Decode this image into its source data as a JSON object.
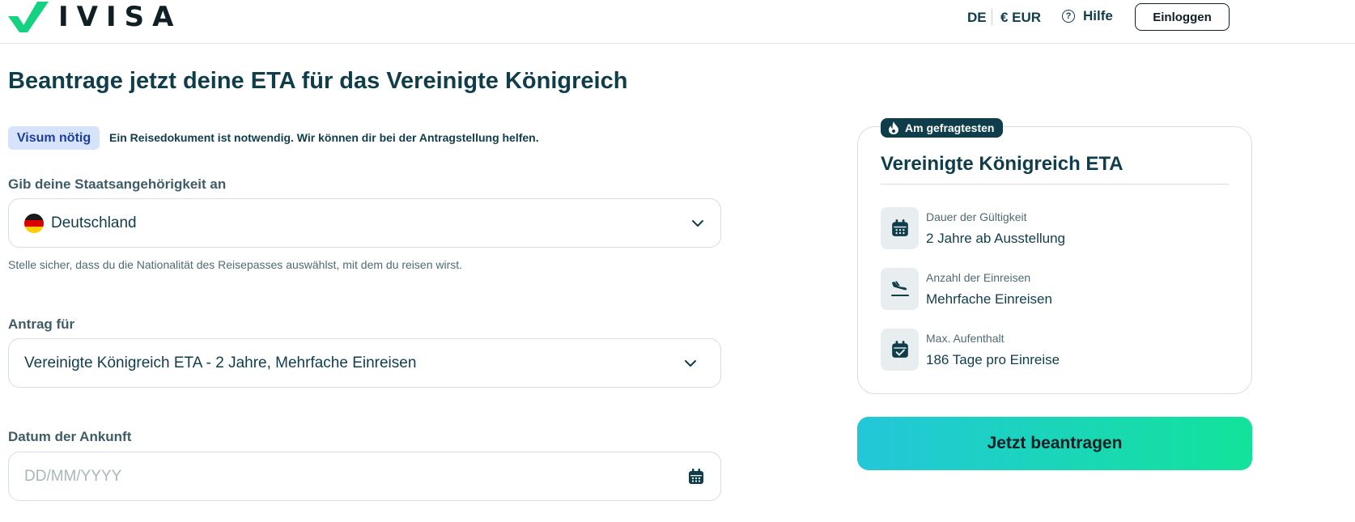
{
  "brand": {
    "name": "IVISA",
    "accent": "#14d27f"
  },
  "header": {
    "language": "DE",
    "currency": "€ EUR",
    "help_label": "Hilfe",
    "login_label": "Einloggen"
  },
  "page": {
    "title": "Beantrage jetzt deine ETA für das Vereinigte Königreich"
  },
  "notice": {
    "badge": "Visum nötig",
    "text": "Ein Reisedokument ist notwendig. Wir können dir bei der Antragstellung helfen."
  },
  "form": {
    "nationality": {
      "label": "Gib deine Staatsangehörigkeit an",
      "value": "Deutschland",
      "hint": "Stelle sicher, dass du die Nationalität des Reisepasses auswählst, mit dem du reisen wirst."
    },
    "application": {
      "label": "Antrag für",
      "value": "Vereinigte Königreich ETA - 2 Jahre, Mehrfache Einreisen"
    },
    "arrival": {
      "label": "Datum der Ankunft",
      "placeholder": "DD/MM/YYYY"
    }
  },
  "card": {
    "badge": "Am gefragtesten",
    "title": "Vereinigte Königreich ETA",
    "rows": [
      {
        "icon": "calendar-grid-icon",
        "label": "Dauer der Gültigkeit",
        "value": "2 Jahre ab Ausstellung"
      },
      {
        "icon": "plane-landing-icon",
        "label": "Anzahl der Einreisen",
        "value": "Mehrfache Einreisen"
      },
      {
        "icon": "calendar-check-icon",
        "label": "Max. Aufenthalt",
        "value": "186 Tage pro Einreise"
      }
    ]
  },
  "cta": {
    "label": "Jetzt beantragen"
  },
  "colors": {
    "text": "#0f3d4a",
    "badge_bg": "#d6e3fb",
    "badge_text": "#1b3d9c",
    "cta_start": "#23c7d9",
    "cta_end": "#12e39a"
  }
}
